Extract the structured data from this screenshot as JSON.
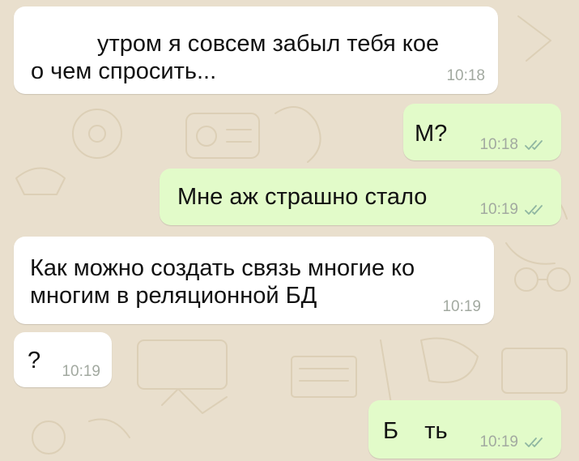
{
  "colors": {
    "background": "#e9dfcd",
    "incoming_bubble": "#ffffff",
    "outgoing_bubble": "#e2fbc9",
    "timestamp": "#a2a9a0",
    "read_ticks": "#8fb6a1"
  },
  "messages": [
    {
      "direction": "incoming",
      "lines": [
        "утром я совсем забыл тебя кое",
        "о чем спросить..."
      ],
      "time": "10:18"
    },
    {
      "direction": "outgoing",
      "text": "М?",
      "time": "10:18",
      "status": "read-double-check-icon"
    },
    {
      "direction": "outgoing",
      "text": "Мне аж страшно стало",
      "time": "10:19",
      "status": "read-double-check-icon"
    },
    {
      "direction": "incoming",
      "lines": [
        "Как можно создать связь многие ко",
        "многим в реляционной БД"
      ],
      "time": "10:19"
    },
    {
      "direction": "incoming",
      "text": "?",
      "time": "10:19"
    },
    {
      "direction": "outgoing",
      "text": "Б    ть",
      "time": "10:19",
      "status": "read-double-check-icon"
    }
  ]
}
